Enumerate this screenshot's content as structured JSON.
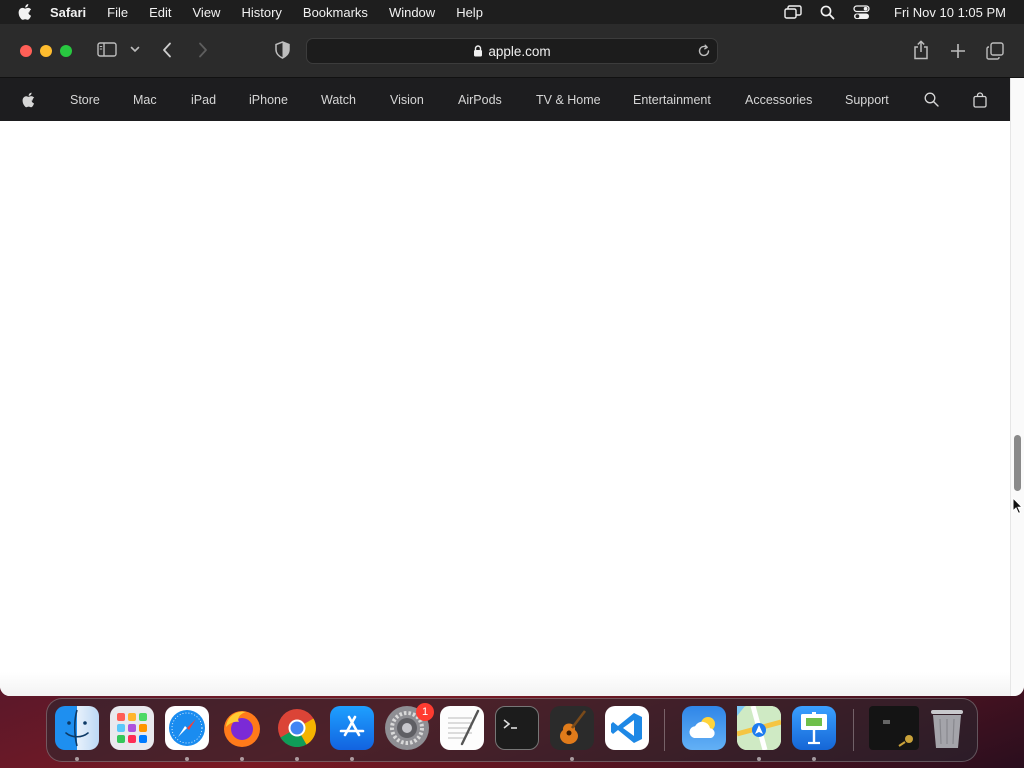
{
  "menubar": {
    "app_name": "Safari",
    "items": [
      "File",
      "Edit",
      "View",
      "History",
      "Bookmarks",
      "Window",
      "Help"
    ],
    "clock": "Fri Nov 10  1:05 PM",
    "status_icons": [
      "screen-mirroring-icon",
      "spotlight-search-icon",
      "control-center-icon"
    ]
  },
  "browser": {
    "address": "apple.com",
    "toolbar_icons": [
      "sidebar-icon",
      "tab-group-chevron-icon",
      "back-icon",
      "forward-icon",
      "privacy-shield-icon",
      "share-icon",
      "new-tab-icon",
      "tab-overview-icon"
    ]
  },
  "apple_nav": {
    "items": [
      "Store",
      "Mac",
      "iPad",
      "iPhone",
      "Watch",
      "Vision",
      "AirPods",
      "TV & Home",
      "Entertainment",
      "Accessories",
      "Support"
    ],
    "icons": [
      "apple-logo-icon",
      "search-icon",
      "bag-icon"
    ]
  },
  "dock": {
    "apps": [
      "Finder",
      "Launchpad",
      "Safari",
      "Firefox",
      "Chrome",
      "App Store",
      "System Settings",
      "TextEdit",
      "Terminal",
      "GarageBand",
      "Visual Studio Code",
      "Weather",
      "Maps",
      "Keynote",
      "Screen Recording",
      "Trash"
    ],
    "settings_badge": "1"
  },
  "colors": {
    "menubar_bg": "#1e1e1e",
    "toolbar_bg": "#2b2b2b",
    "nav_bg": "#1d1d1f",
    "close": "#ff5f57",
    "minimize": "#febc2e",
    "zoom": "#28c840"
  }
}
